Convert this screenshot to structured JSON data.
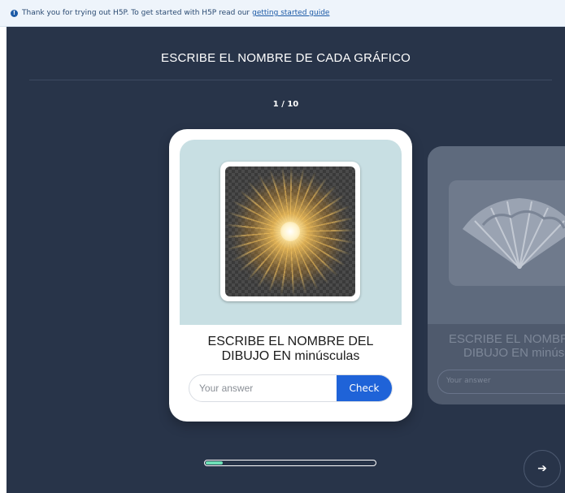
{
  "notice": {
    "text": "Thank you for trying out H5P. To get started with H5P read our",
    "link": "getting started guide",
    "icon": "info-icon"
  },
  "header": {
    "title": "ESCRIBE EL NOMBRE DE CADA GRÁFICO",
    "counter": "1 / 10"
  },
  "current_card": {
    "prompt_line1": "ESCRIBE EL NOMBRE DEL",
    "prompt_line2": "DIBUJO EN minúsculas",
    "answer_placeholder": "Your answer",
    "check_label": "Check",
    "image": "light-burst-image"
  },
  "next_card": {
    "prompt_line1": "ESCRIBE EL NOMBRE DEL",
    "prompt_line2": "DIBUJO EN minúsculas",
    "answer_placeholder": "Your answer",
    "image": "hand-fan-image"
  },
  "progress": {
    "current": 1,
    "total": 10,
    "fraction": 0.1
  },
  "navigation": {
    "next_icon": "arrow-right-icon",
    "next_glyph": "➔"
  },
  "colors": {
    "background": "#283449",
    "accent": "#1f63d8",
    "progress": "#6ee0b6",
    "image_area": "#c8dfe3"
  }
}
